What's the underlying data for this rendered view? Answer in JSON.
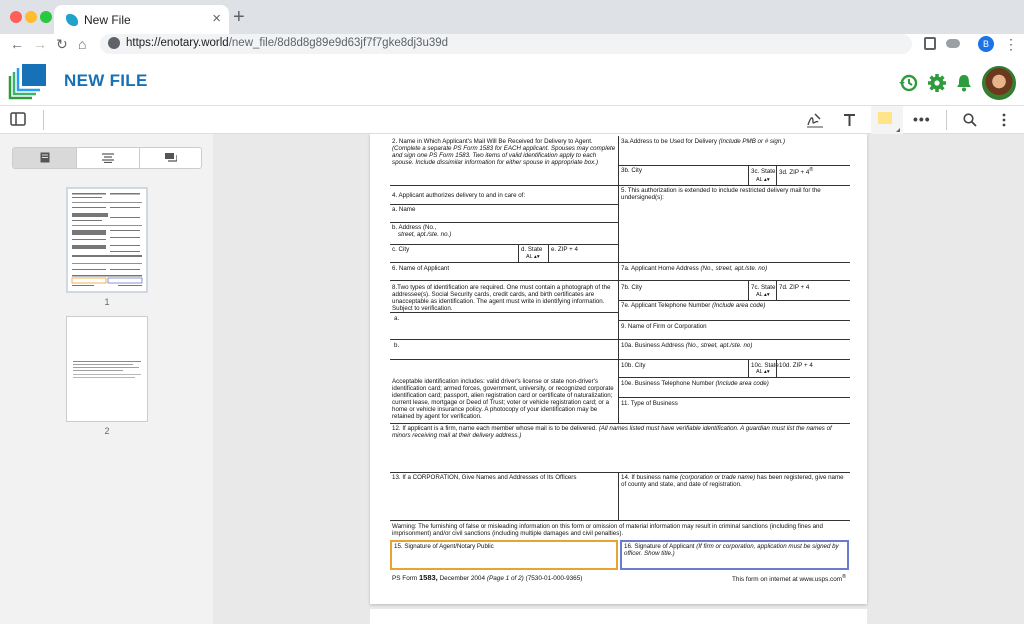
{
  "browser": {
    "tab_title": "New File",
    "tab_close": "×",
    "new_tab": "+",
    "url_host": "https://enotary.world",
    "url_path": "/new_file/8d8d8g89e9d63jf7f7gke8dj3u39d",
    "back": "←",
    "forward": "→",
    "reload": "↻",
    "home": "⌂",
    "profile_initial": "B",
    "menu": "⋮"
  },
  "colors": {
    "brand": "#1671b6",
    "green": "#2e9c3c",
    "sig_orange": "#e8a433",
    "sig_blue": "#6a7bd0"
  },
  "app": {
    "title": "NEW FILE"
  },
  "sidebar": {
    "thumb_numbers": [
      "1",
      "2"
    ]
  },
  "form": {
    "f2": "2. Name in Which Applicant's Mail Will Be Received for Delivery to Agent.",
    "f2_note": "(Complete a separate PS Form 1583 for EACH applicant. Spouses may complete and sign one PS Form 1583. Two items of valid identification apply to each spouse. Include dissimilar information for either spouse in appropriate box.)",
    "f3a": "3a.Address to be Used for Delivery",
    "f3a_note": "(Include PMB or # sign.)",
    "f3b": "3b. City",
    "f3c": "3c. State",
    "f3c_val": "AL",
    "f3d": "3d. ZIP + 4",
    "f3d_sup": "®",
    "f4": "4. Applicant authorizes delivery to and in care of:",
    "f4a": "a. Name",
    "f4b": "b. Address (No.,",
    "f4b_note": "street, apt./ste. no.)",
    "f4c": "c. City",
    "f4d": "d. State",
    "f4d_val": "AL",
    "f4e": "e. ZIP + 4",
    "f5": "5. This authorization is extended to include restricted delivery mail for the undersigned(s):",
    "f6": "6. Name of Applicant",
    "f7a": "7a. Applicant Home Address",
    "f7a_note": "(No., street, apt./ste. no)",
    "f7b": "7b. City",
    "f7c": "7c. State",
    "f7c_val": "AL",
    "f7d": "7d. ZIP + 4",
    "f7e": "7e. Applicant Telephone Number",
    "f7e_note": "(Include area code)",
    "f8": "8.Two types of identification are required. One must contain a photograph of the addressee(s). Social Security cards, credit cards, and birth certificates are unacceptable as identification. The agent must write in identifying information. Subject to verification.",
    "f8a": "a.",
    "f8b": "b.",
    "f8_accept": "Acceptable identification includes: valid driver's license or state non-driver's identification card; armed forces, government, university, or recognized corporate identification card; passport, alien registration card or certificate of naturalization; current lease, mortgage or Deed of Trust; voter or vehicle registration card; or a home or vehicle insurance policy. A photocopy of your identification may be retained by agent for verification.",
    "f9": "9. Name of Firm or Corporation",
    "f10a": "10a. Business Address",
    "f10a_note": "(No., street, apt./ste. no)",
    "f10b": "10b. City",
    "f10c": "10c. State",
    "f10c_val": "AL",
    "f10d": "10d. ZIP + 4",
    "f10e": "10e. Business Telephone Number",
    "f10e_note": "(Include area code)",
    "f11": "11. Type of Business",
    "f12": "12. If applicant is a firm, name each member whose mail is to be delivered.",
    "f12_note": "(All names listed must have verifiable identification. A guardian must list the names of minors receiving mail at their delivery address.)",
    "f13": "13. If a CORPORATION, Give Names and Addresses of Its Officers",
    "f14": "14. If business name",
    "f14_note": "(corporation or trade name)",
    "f14_rest": "has been registered, give name of county and state, and date of registration.",
    "warning": "Warning: The furnishing of false or misleading information on this form or omission of material information may result in criminal sanctions (including fines and imprisonment) and/or civil sanctions (including multiple damages and civil penalties).",
    "f15": "15. Signature of Agent/Notary Public",
    "f16": "16. Signature of Applicant",
    "f16_note": "(If firm or corporation, application must be signed by officer. Show title.)",
    "footer_left_a": "PS Form",
    "footer_left_b": "1583,",
    "footer_left_c": "December 2004",
    "footer_left_d": "(Page 1 of 2)",
    "footer_left_e": "(7530-01-000-9365)",
    "footer_right": "This form on internet at www.usps.com",
    "footer_right_sup": "®"
  }
}
